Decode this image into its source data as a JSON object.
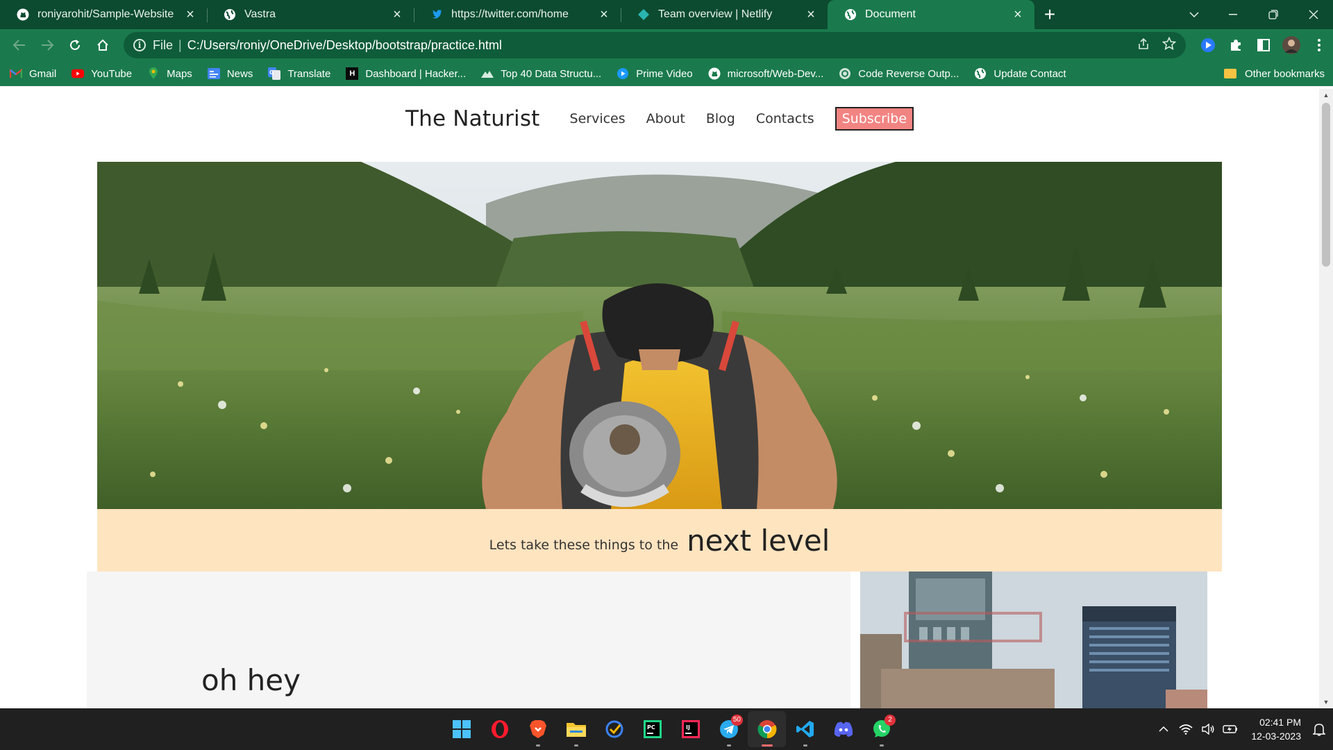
{
  "browser": {
    "tabs": [
      {
        "title": "roniyarohit/Sample-Website",
        "icon": "github-icon",
        "active": false
      },
      {
        "title": "Vastra",
        "icon": "globe-icon",
        "active": false
      },
      {
        "title": "https://twitter.com/home",
        "icon": "twitter-icon",
        "active": false
      },
      {
        "title": "Team overview | Netlify",
        "icon": "netlify-icon",
        "active": false
      },
      {
        "title": "Document",
        "icon": "globe-icon",
        "active": true
      }
    ],
    "address": {
      "scheme_label": "File",
      "url": "C:/Users/roniy/OneDrive/Desktop/bootstrap/practice.html"
    },
    "bookmarks": [
      {
        "label": "Gmail",
        "icon": "gmail-icon"
      },
      {
        "label": "YouTube",
        "icon": "youtube-icon"
      },
      {
        "label": "Maps",
        "icon": "maps-icon"
      },
      {
        "label": "News",
        "icon": "news-icon"
      },
      {
        "label": "Translate",
        "icon": "translate-icon"
      },
      {
        "label": "Dashboard | Hacker...",
        "icon": "hackerrank-icon"
      },
      {
        "label": "Top 40 Data Structu...",
        "icon": "mountain-icon"
      },
      {
        "label": "Prime Video",
        "icon": "prime-video-icon"
      },
      {
        "label": "microsoft/Web-Dev...",
        "icon": "github-icon"
      },
      {
        "label": "Code Reverse Outp...",
        "icon": "code-icon"
      },
      {
        "label": "Update Contact",
        "icon": "globe-icon"
      }
    ],
    "other_bookmarks": "Other bookmarks",
    "colors": {
      "frame": "#0c4b30",
      "toolbar": "#1a7a4d"
    }
  },
  "site": {
    "brand": "The Naturist",
    "nav": [
      "Services",
      "About",
      "Blog",
      "Contacts"
    ],
    "subscribe": "Subscribe",
    "banner_small": "Lets take these things to the",
    "banner_big": "next level",
    "section_heading": "oh hey",
    "colors": {
      "subscribe": "#f28482",
      "banner": "#ffe4c0"
    }
  },
  "taskbar": {
    "apps": [
      {
        "name": "windows-start-icon"
      },
      {
        "name": "opera-icon"
      },
      {
        "name": "brave-icon"
      },
      {
        "name": "file-explorer-icon"
      },
      {
        "name": "todo-icon"
      },
      {
        "name": "pycharm-icon"
      },
      {
        "name": "intellij-icon"
      },
      {
        "name": "telegram-icon",
        "badge": "50"
      },
      {
        "name": "chrome-icon",
        "active": true
      },
      {
        "name": "vscode-icon"
      },
      {
        "name": "discord-icon"
      },
      {
        "name": "whatsapp-icon",
        "badge": "2"
      }
    ],
    "time": "02:41 PM",
    "date": "12-03-2023"
  }
}
